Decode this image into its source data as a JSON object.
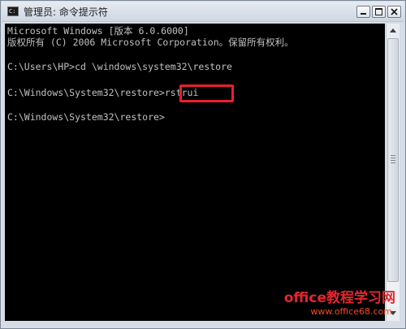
{
  "window": {
    "title": "管理员: 命令提示符",
    "icon": "cmd-icon"
  },
  "console": {
    "lines": [
      "Microsoft Windows [版本 6.0.6000]",
      "版权所有 (C) 2006 Microsoft Corporation。保留所有权利。",
      "",
      "C:\\Users\\HP>cd \\windows\\system32\\restore",
      "",
      "C:\\Windows\\System32\\restore>rstrui",
      "",
      "C:\\Windows\\System32\\restore>"
    ],
    "highlighted_command": "rstrui"
  },
  "watermark": {
    "title": "office教程学习网",
    "url": "www.office68.com"
  },
  "colors": {
    "console_background": "#000000",
    "console_text": "#c0c0c0",
    "highlight_border": "#e8202c",
    "watermark": "#e3262d"
  }
}
